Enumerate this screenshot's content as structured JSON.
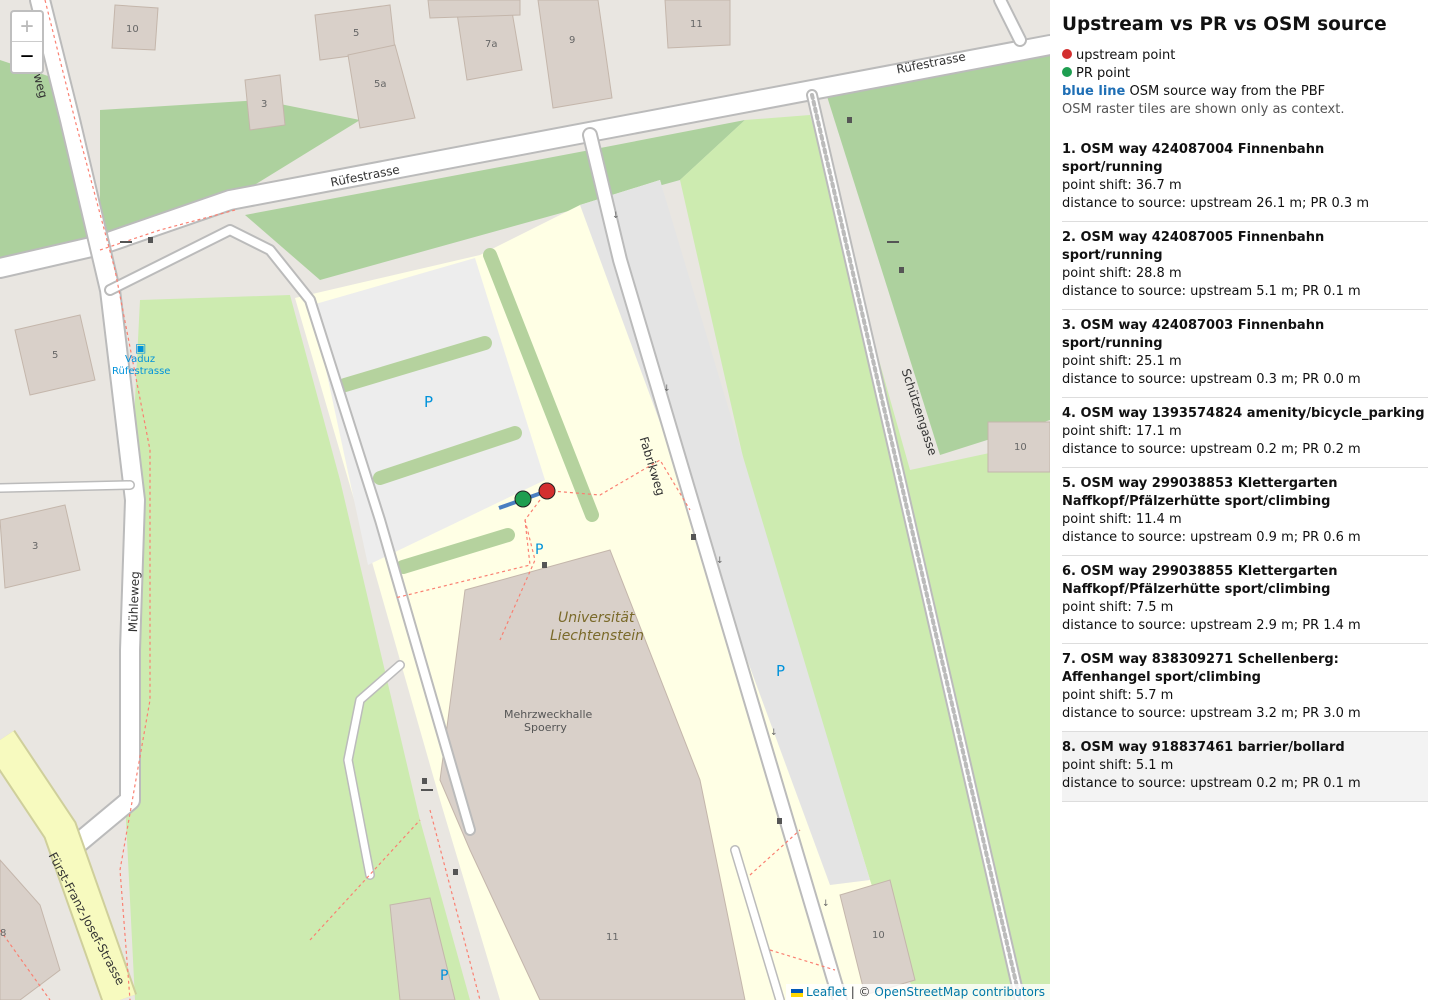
{
  "panel": {
    "title": "Upstream vs PR vs OSM source",
    "legend": {
      "upstream_label": "upstream point",
      "upstream_color": "#d32f2f",
      "pr_label": "PR point",
      "pr_color": "#1e9e50",
      "blue_label": "blue line",
      "blue_desc": " OSM source way from the PBF",
      "note": "OSM raster tiles are shown only as context."
    },
    "items": [
      {
        "title": "1. OSM way 424087004 Finnenbahn sport/running",
        "shift": "point shift: 36.7 m",
        "dist": "distance to source: upstream 26.1 m; PR 0.3 m"
      },
      {
        "title": "2. OSM way 424087005 Finnenbahn sport/running",
        "shift": "point shift: 28.8 m",
        "dist": "distance to source: upstream 5.1 m; PR 0.1 m"
      },
      {
        "title": "3. OSM way 424087003 Finnenbahn sport/running",
        "shift": "point shift: 25.1 m",
        "dist": "distance to source: upstream 0.3 m; PR 0.0 m"
      },
      {
        "title": "4. OSM way 1393574824 amenity/bicycle_parking",
        "shift": "point shift: 17.1 m",
        "dist": "distance to source: upstream 0.2 m; PR 0.2 m"
      },
      {
        "title": "5. OSM way 299038853 Klettergarten Naffkopf/Pfälzerhütte sport/climbing",
        "shift": "point shift: 11.4 m",
        "dist": "distance to source: upstream 0.9 m; PR 0.6 m"
      },
      {
        "title": "6. OSM way 299038855 Klettergarten Naffkopf/Pfälzerhütte sport/climbing",
        "shift": "point shift: 7.5 m",
        "dist": "distance to source: upstream 2.9 m; PR 1.4 m"
      },
      {
        "title": "7. OSM way 838309271 Schellenberg: Affenhangel sport/climbing",
        "shift": "point shift: 5.7 m",
        "dist": "distance to source: upstream 3.2 m; PR 3.0 m"
      },
      {
        "title": "8. OSM way 918837461 barrier/bollard",
        "shift": "point shift: 5.1 m",
        "dist": "distance to source: upstream 0.2 m; PR 0.1 m"
      }
    ]
  },
  "map": {
    "zoom_in": "+",
    "zoom_out": "−",
    "attribution_leaflet": "Leaflet",
    "attribution_sep": " | © ",
    "attribution_osm": "OpenStreetMap contributors",
    "labels": {
      "rufestrasse_1": "Rüfestrasse",
      "rufestrasse_2": "Rüfestrasse",
      "fabrikweg": "Fabrikweg",
      "schutzengasse": "Schützengasse",
      "muhleweg": "Mühleweg",
      "muhleweg_top": "weg",
      "fff": "Fürst-Franz-Josef-Strasse",
      "uni_1": "Universität",
      "uni_2": "Liechtenstein",
      "hall_1": "Mehrzweckhalle",
      "hall_2": "Spoerry",
      "bus_1": "Vaduz",
      "bus_2": "Rüfestrasse",
      "p1": "P",
      "p2": "P",
      "hn_10a": "10",
      "hn_5a": "5",
      "hn_5b": "5a",
      "hn_7a": "7a",
      "hn_9": "9",
      "hn_11a": "11",
      "hn_3a": "3",
      "hn_5c": "5",
      "hn_3b": "3",
      "hn_10b": "10",
      "hn_11b": "11",
      "hn_10c": "10",
      "hn_8": "8"
    }
  }
}
